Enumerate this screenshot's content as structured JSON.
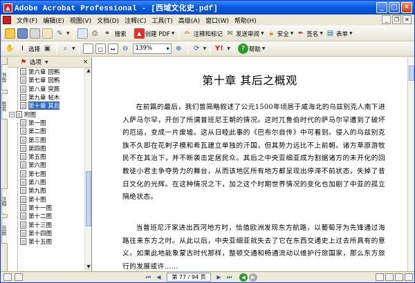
{
  "window": {
    "title": "Adobe Acrobat Professional - [西域文化史.pdf]",
    "app_icon_glyph": "▲",
    "min_glyph": "_",
    "max_glyph": "□",
    "close_glyph": "✕"
  },
  "menu": [
    "文件(F)",
    "编辑(E)",
    "视图(V)",
    "文档(D)",
    "注释(C)",
    "工具(T)",
    "高级(A)",
    "窗口(W)",
    "帮助(H)"
  ],
  "toolbar1": {
    "open_label": "",
    "search_label": "搜索",
    "create_pdf_label": "创建 PDF",
    "review_label": "注释和标记",
    "send_label": "发送审阅",
    "secure_label": "安全",
    "sign_label": "签名",
    "forms_label": "表单",
    "print_label": "打印"
  },
  "toolbar2": {
    "select_label": "选择",
    "zoom_value": "139%",
    "help_label": "帮助"
  },
  "panel": {
    "options_label": "选项",
    "close_glyph": "×",
    "tabs": [
      "书签",
      "签名",
      "注释",
      "页面"
    ],
    "items": [
      {
        "label": "第六章 回鹘",
        "level": 2
      },
      {
        "label": "第七章 回鹘",
        "level": 2
      },
      {
        "label": "第八章 突厥",
        "level": 2
      },
      {
        "label": "第九章 帖木",
        "level": 2
      },
      {
        "label": "第十章 其后",
        "level": 2,
        "selected": true
      },
      {
        "label": "附图",
        "level": 1
      },
      {
        "label": "第一图",
        "level": 2
      },
      {
        "label": "第二图",
        "level": 2
      },
      {
        "label": "第三图",
        "level": 2
      },
      {
        "label": "第四图",
        "level": 2
      },
      {
        "label": "第五图",
        "level": 2
      },
      {
        "label": "第六图",
        "level": 2
      },
      {
        "label": "第七图",
        "level": 2
      },
      {
        "label": "第八图",
        "level": 2
      },
      {
        "label": "第九图",
        "level": 2
      },
      {
        "label": "第十图",
        "level": 2
      },
      {
        "label": "第十一图",
        "level": 2
      },
      {
        "label": "第十二图",
        "level": 2
      },
      {
        "label": "第十三图",
        "level": 2
      },
      {
        "label": "第十四图",
        "level": 2
      },
      {
        "label": "第十五图",
        "level": 2
      }
    ]
  },
  "document": {
    "chapter_title": "第十章  其后之概观",
    "paragraph1": "在前篇的最后，我们曾简略叙述了公元1500年顷居于咸海北的乌兹别克人南下进入萨马尔罕，开创了所谓普班尼王朝的情况。这时兀鲁伯时代的萨马尔罕遭到了破坏的厄运，变成一片废墟。这从日睦此事的《巴布尔自传》中可看到。侵入的乌兹别克族不久即在花剌子模和希瓦建立单独的汗国，但其势力远比不上前朝。诸方草原游牧民不在其治下，并不断袭击定居民众。其后之中央亚细亚成为割据诸方的未开化的回教徒小君主争夺势力的舞台，从而该地区所有地方都呈现出停滞不前状态，失掉了昔日文化的光辉。在这种情况之下，加之这个时期世界情况的变化也加剧了中亚的孤立隔绝状态。",
    "paragraph2": "当普班尼汗家进出西河地方时，恰值欧洲发现东方航路，以葡萄牙为先锋通过海路往来东方之时。从此以后，中央亚细亚就失去了它在东西交通史上过去所具有的意义。如果此地能象蒙古时代那样，整顿交通和畅通流动以维护行旅国家，那么东方旅行的发展或许……"
  },
  "status": {
    "page_display": "第 77 / 94 页"
  }
}
